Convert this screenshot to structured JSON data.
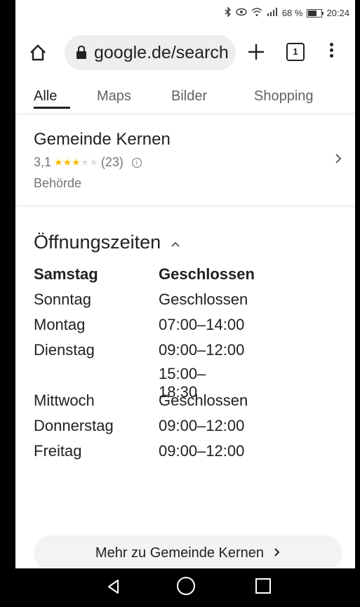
{
  "status_bar": {
    "battery_text": "68 %",
    "battery_level": 0.68,
    "time": "20:24",
    "icons": [
      "bluetooth-icon",
      "eye-icon",
      "wifi-icon",
      "signal-icon",
      "battery-icon"
    ]
  },
  "toolbar": {
    "url": "google.de/search",
    "tab_count": "1",
    "icons": [
      "home-icon",
      "lock-icon",
      "plus-icon",
      "menu-icon"
    ]
  },
  "tabs": [
    {
      "label": "Alle",
      "active": true
    },
    {
      "label": "Maps",
      "active": false
    },
    {
      "label": "Bilder",
      "active": false
    },
    {
      "label": "Shopping",
      "active": false
    }
  ],
  "business": {
    "name": "Gemeinde Kernen",
    "rating": "3,1",
    "rating_value": 3.1,
    "stars_total": 5,
    "stars_filled": 3,
    "reviews": "(23)",
    "category": "Behörde"
  },
  "hours": {
    "title": "Öffnungszeiten",
    "rows": [
      {
        "day": "Samstag",
        "time": "Geschlossen",
        "time2": "",
        "bold": true
      },
      {
        "day": "Sonntag",
        "time": "Geschlossen",
        "time2": "",
        "bold": false
      },
      {
        "day": "Montag",
        "time": "07:00–14:00",
        "time2": "",
        "bold": false
      },
      {
        "day": "Dienstag",
        "time": "09:00–12:00",
        "time2": "15:00–18:30",
        "bold": false
      },
      {
        "day": "Mittwoch",
        "time": "Geschlossen",
        "time2": "",
        "bold": false
      },
      {
        "day": "Donnerstag",
        "time": "09:00–12:00",
        "time2": "",
        "bold": false
      },
      {
        "day": "Freitag",
        "time": "09:00–12:00",
        "time2": "",
        "bold": false
      }
    ]
  },
  "more_button": {
    "label": "Mehr zu Gemeinde Kernen"
  },
  "colors": {
    "star": "#fbbc04",
    "star_off": "#dadce0",
    "text": "#202124",
    "secondary": "#70757a"
  },
  "nav": {
    "icons": [
      "back-icon",
      "home-icon",
      "recents-icon"
    ]
  }
}
